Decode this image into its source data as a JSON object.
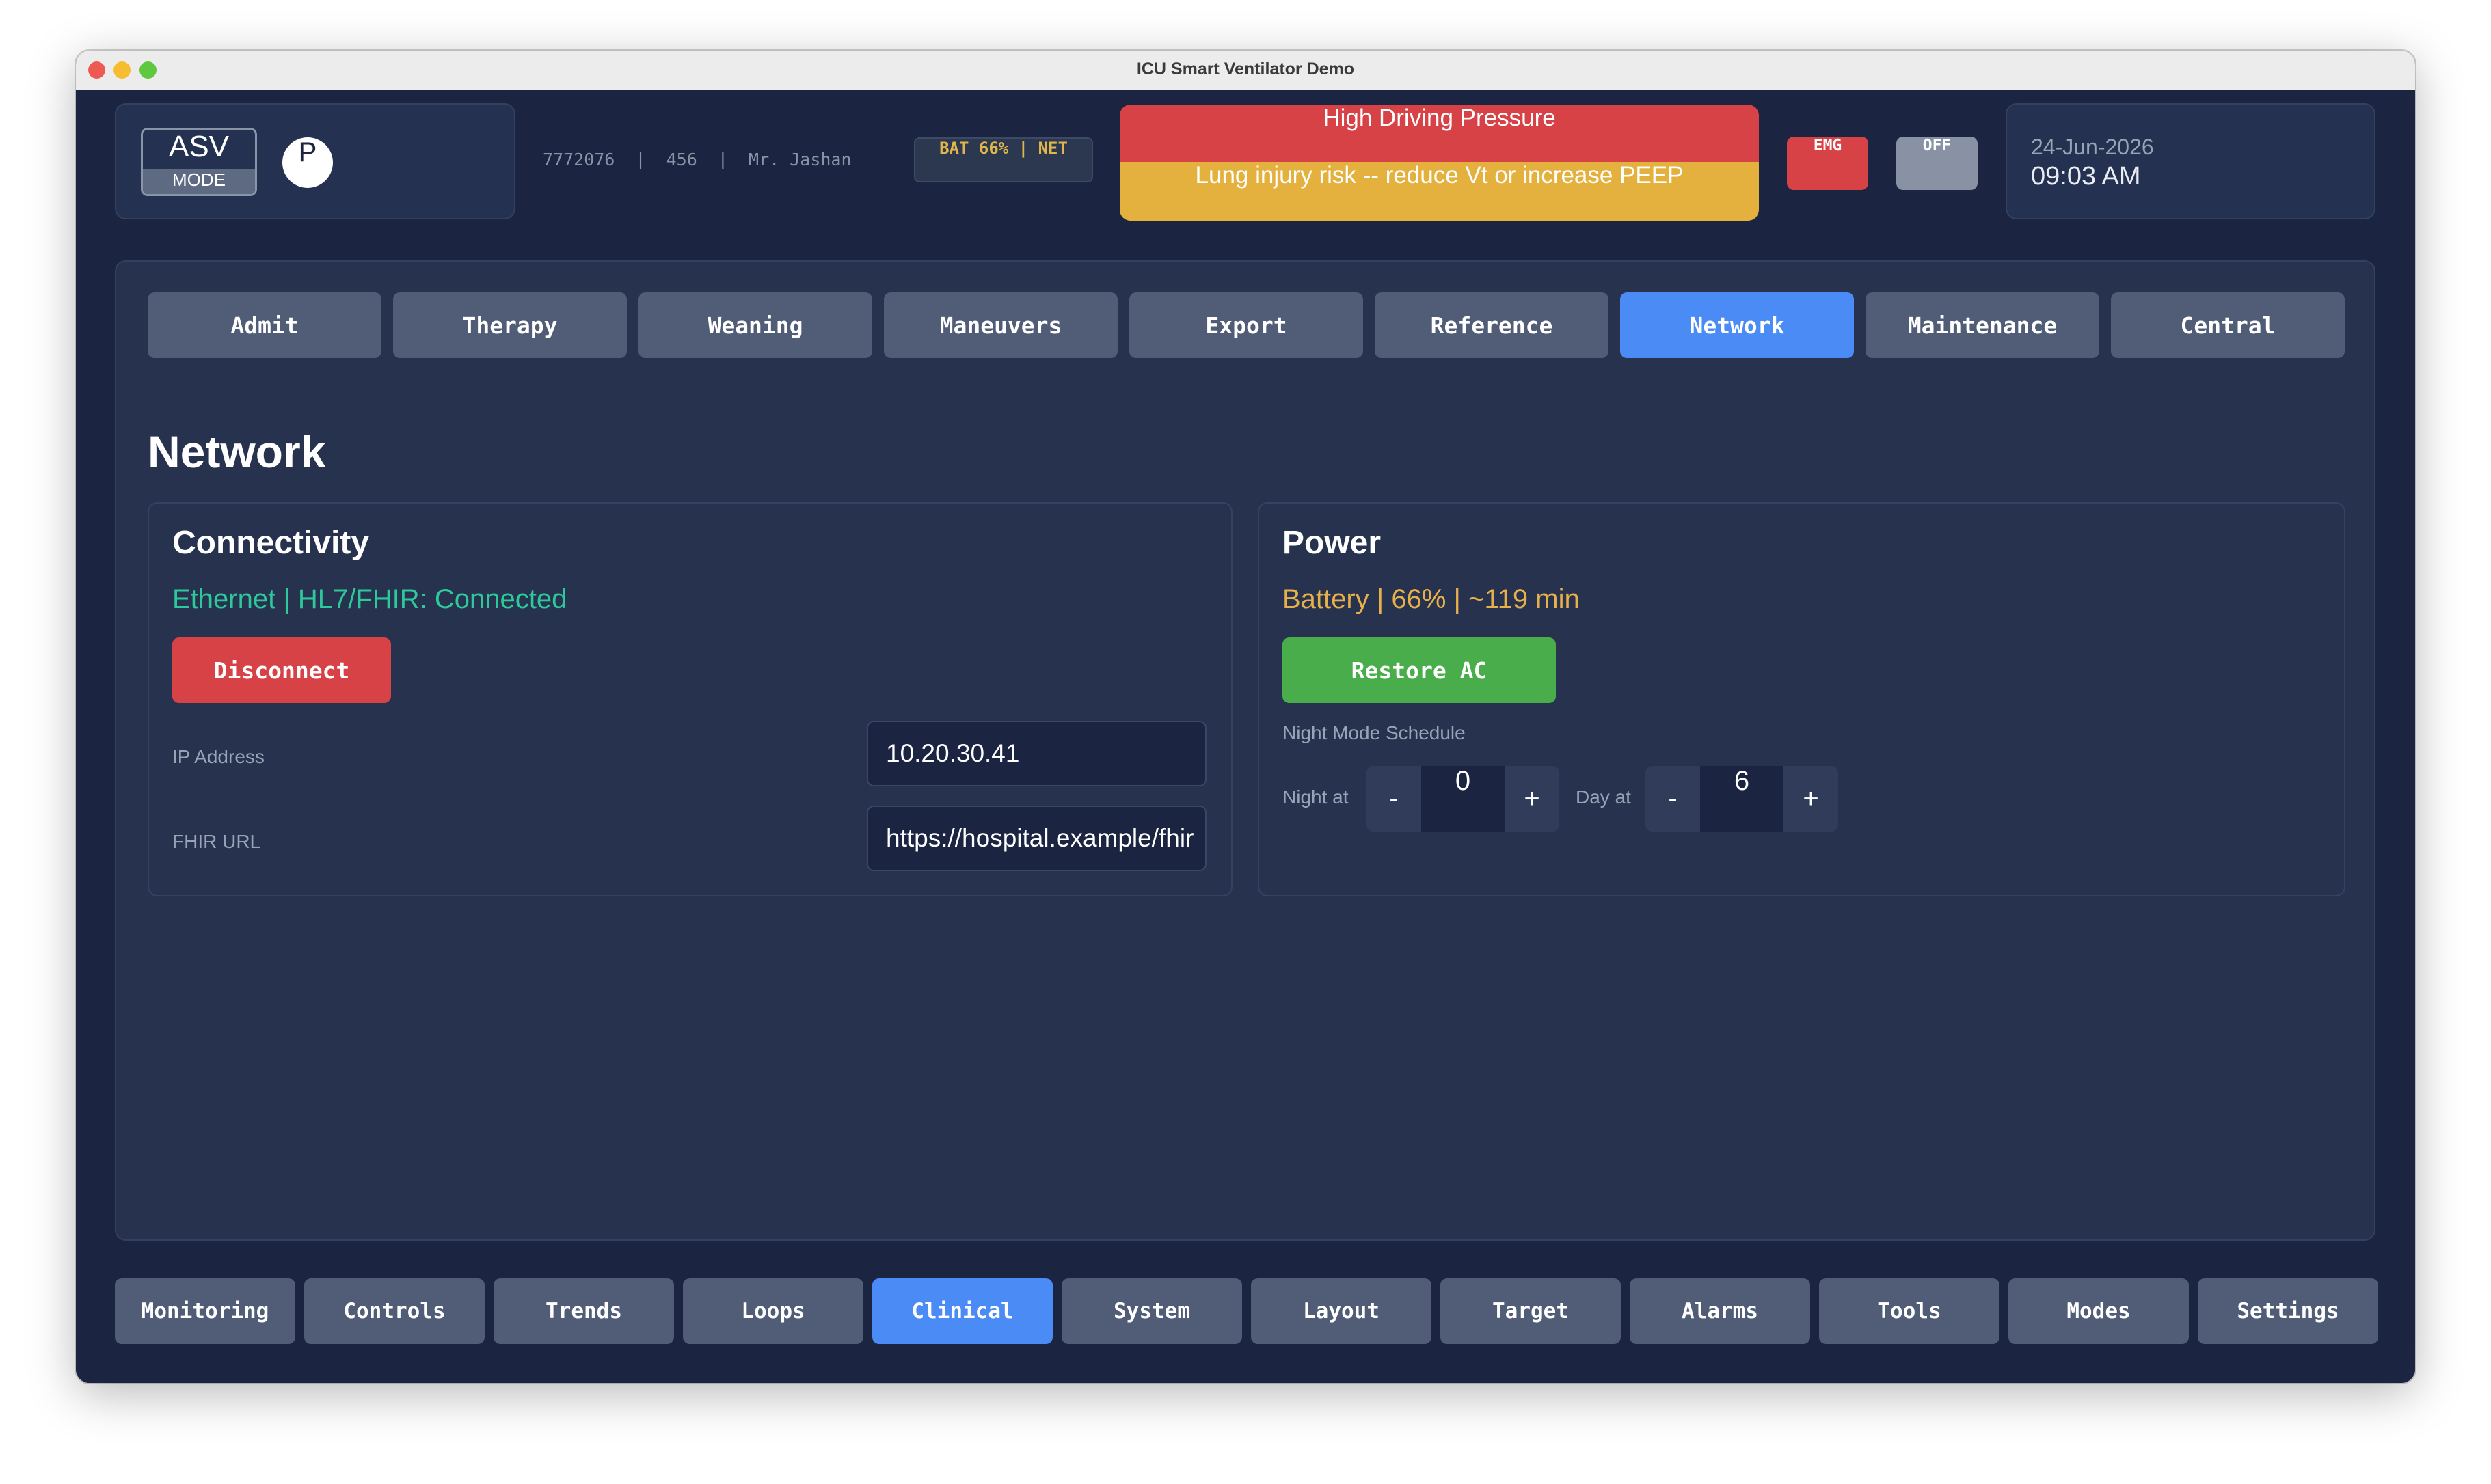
{
  "window": {
    "title": "ICU Smart Ventilator Demo"
  },
  "header": {
    "mode": {
      "name": "ASV",
      "label": "MODE"
    },
    "patient_initial": "P",
    "patient_info": "7772076  |  456  |  Mr. Jashan",
    "battery_network": "BAT 66% | NET",
    "alarm": {
      "title": "High Driving Pressure",
      "message": "Lung injury risk -- reduce Vt or increase PEEP"
    },
    "emergency_label": "EMG",
    "off_label": "OFF",
    "date": "24-Jun-2026",
    "time": "09:03 AM"
  },
  "colors": {
    "background": "#1b2440",
    "panel": "#27324f",
    "accent_active": "#4a8bf5",
    "tab_inactive": "#515d77",
    "alarm_red": "#d74246",
    "alarm_amber": "#e5b13e",
    "status_green": "#2ec99a",
    "status_amber": "#e8b04a",
    "button_green": "#48ad4a"
  },
  "top_tabs": [
    {
      "label": "Admit"
    },
    {
      "label": "Therapy"
    },
    {
      "label": "Weaning"
    },
    {
      "label": "Maneuvers"
    },
    {
      "label": "Export"
    },
    {
      "label": "Reference"
    },
    {
      "label": "Network",
      "active": true
    },
    {
      "label": "Maintenance"
    },
    {
      "label": "Central"
    }
  ],
  "section_title": "Network",
  "connectivity": {
    "title": "Connectivity",
    "status": "Ethernet  |  HL7/FHIR: Connected",
    "disconnect_label": "Disconnect",
    "ip_label": "IP Address",
    "ip_value": "10.20.30.41",
    "fhir_label": "FHIR URL",
    "fhir_value": "https://hospital.example/fhir"
  },
  "power": {
    "title": "Power",
    "status": "Battery  |  66%  |  ~119 min",
    "restore_label": "Restore AC",
    "schedule_label": "Night Mode Schedule",
    "night_label": "Night at",
    "night_value": "0",
    "day_label": "Day at",
    "day_value": "6",
    "minus_symbol": "-",
    "plus_symbol": "+"
  },
  "bottom_tabs": [
    {
      "label": "Monitoring"
    },
    {
      "label": "Controls"
    },
    {
      "label": "Trends"
    },
    {
      "label": "Loops"
    },
    {
      "label": "Clinical",
      "active": true
    },
    {
      "label": "System"
    },
    {
      "label": "Layout"
    },
    {
      "label": "Target"
    },
    {
      "label": "Alarms"
    },
    {
      "label": "Tools"
    },
    {
      "label": "Modes"
    },
    {
      "label": "Settings"
    }
  ]
}
